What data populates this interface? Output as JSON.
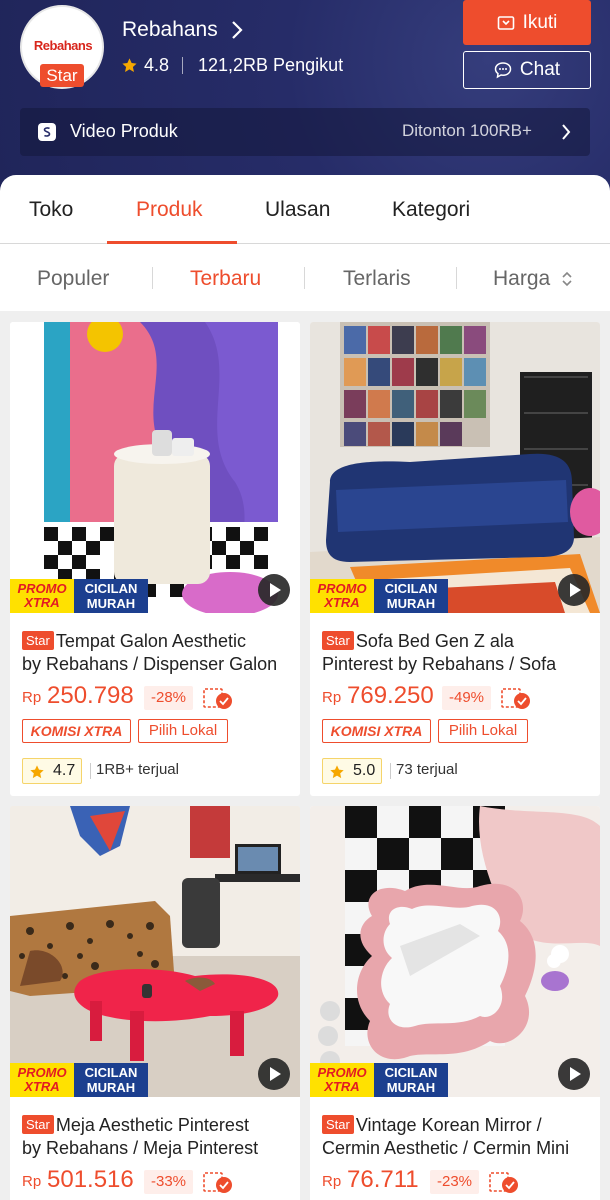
{
  "shop": {
    "logo_text": "Rebahans",
    "badge": "Star",
    "name": "Rebahans",
    "rating": "4.8",
    "followers": "121,2RB Pengikut",
    "follow_label": "Ikuti",
    "chat_label": "Chat"
  },
  "video_bar": {
    "label": "Video Produk",
    "views": "Ditonton 100RB+"
  },
  "tabs": [
    {
      "label": "Toko"
    },
    {
      "label": "Produk",
      "active": true
    },
    {
      "label": "Ulasan"
    },
    {
      "label": "Kategori"
    }
  ],
  "sort": [
    {
      "label": "Populer"
    },
    {
      "label": "Terbaru",
      "active": true
    },
    {
      "label": "Terlaris"
    },
    {
      "label": "Harga"
    }
  ],
  "promo": {
    "line1": "PROMO",
    "line2": "XTRA",
    "line3": "CICILAN",
    "line4": "MURAH"
  },
  "tags": {
    "komisi": "KOMISI XTRA",
    "lokal": "Pilih Lokal"
  },
  "products": [
    {
      "star": "Star",
      "title_line1": "Tempat Galon Aesthetic",
      "title_line2": "by Rebahans / Dispenser Galon",
      "currency": "Rp",
      "price": "250.798",
      "discount": "-28%",
      "rating": "4.7",
      "sold": "1RB+ terjual"
    },
    {
      "star": "Star",
      "title_line1": "Sofa Bed Gen Z ala",
      "title_line2": "Pinterest by Rebahans / Sofa",
      "currency": "Rp",
      "price": "769.250",
      "discount": "-49%",
      "rating": "5.0",
      "sold": "73 terjual"
    },
    {
      "star": "Star",
      "title_line1": "Meja Aesthetic Pinterest",
      "title_line2": "by Rebahans / Meja Pinterest",
      "currency": "Rp",
      "price": "501.516",
      "discount": "-33%"
    },
    {
      "star": "Star",
      "title_line1": "Vintage Korean Mirror /",
      "title_line2": "Cermin Aesthetic / Cermin Mini",
      "currency": "Rp",
      "price": "76.711",
      "discount": "-23%"
    }
  ],
  "colors": {
    "accent": "#ee4d2d",
    "header_bg": "#262c68"
  }
}
